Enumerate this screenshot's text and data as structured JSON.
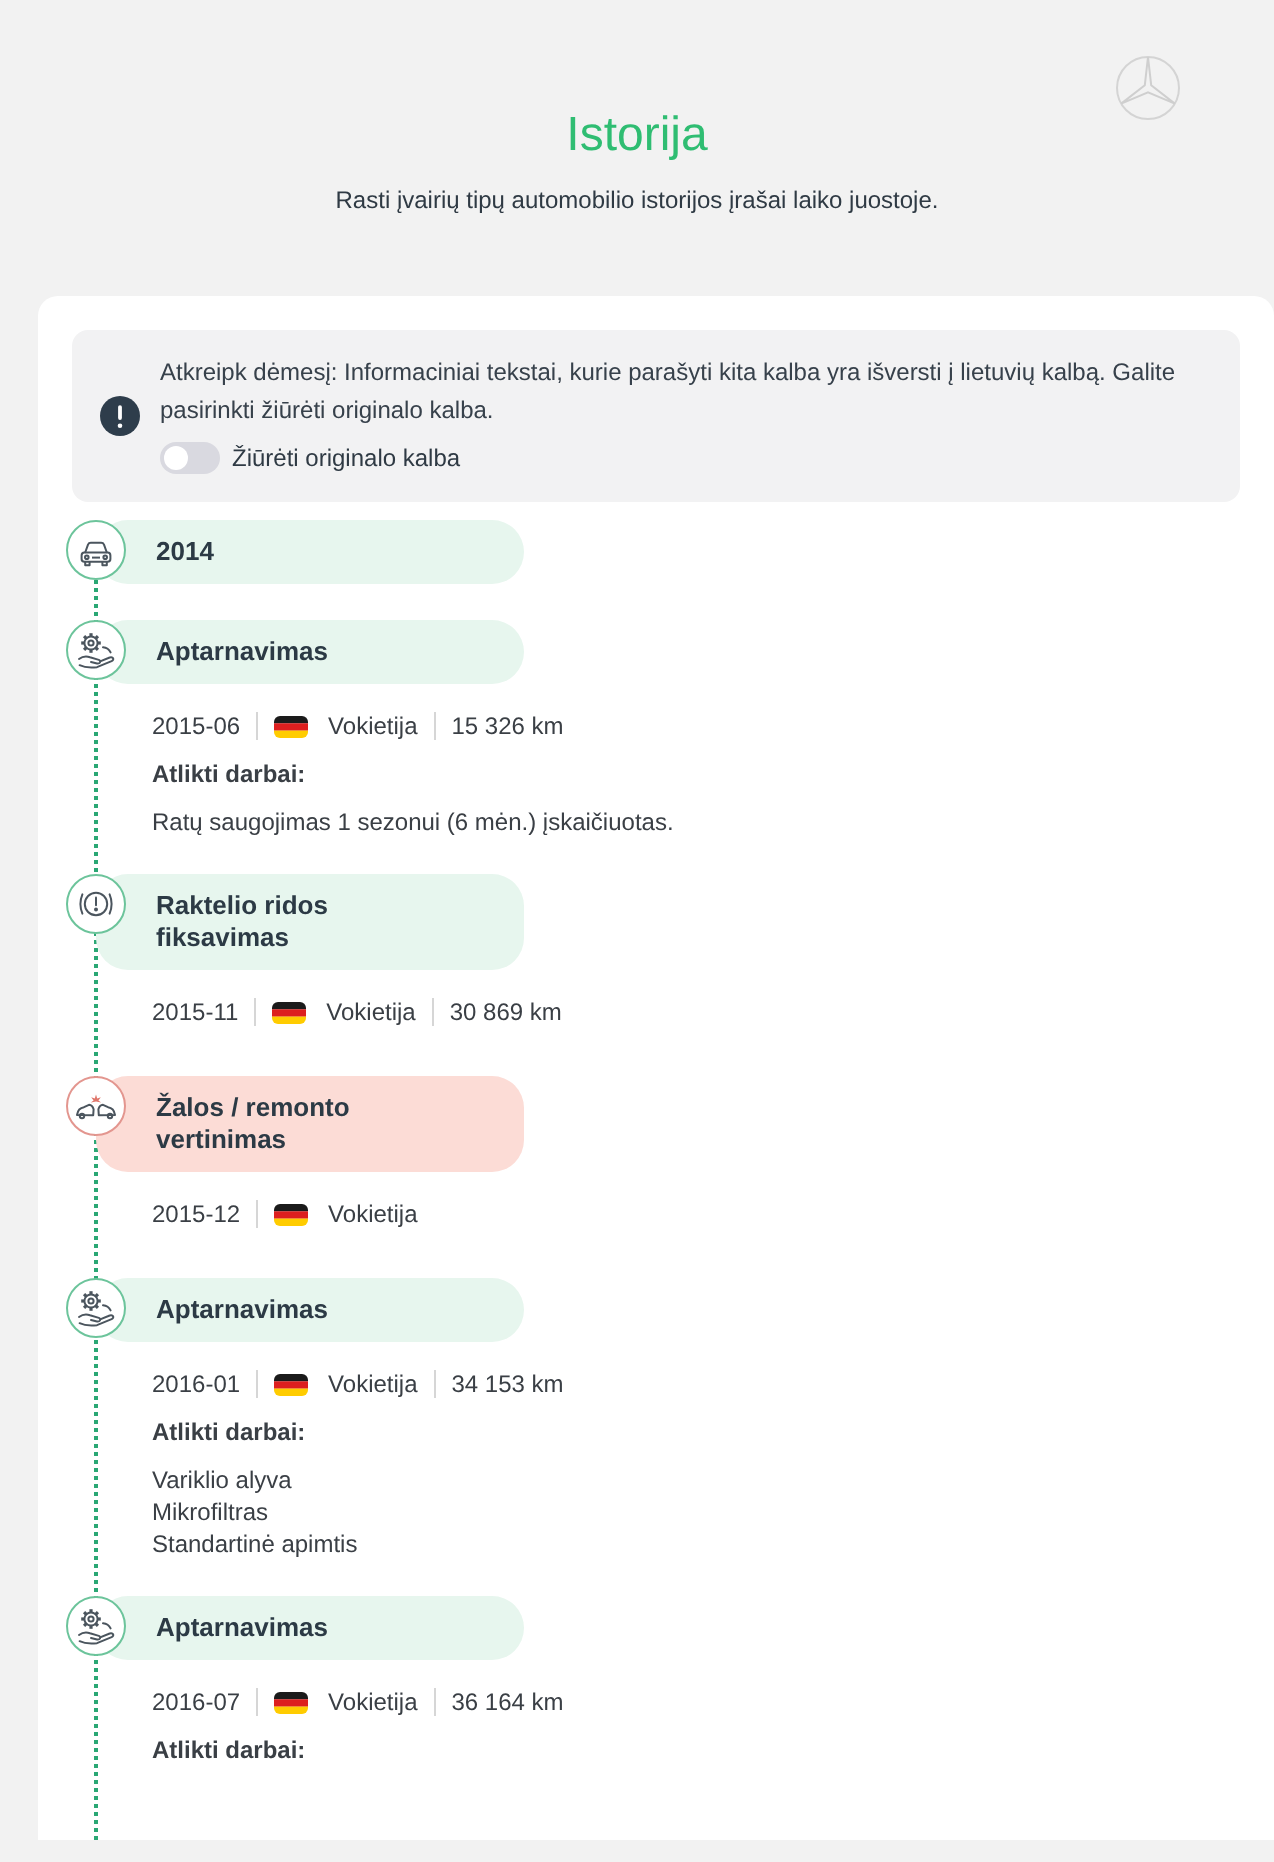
{
  "header": {
    "title": "Istorija",
    "subtitle": "Rasti įvairių tipų automobilio istorijos įrašai laiko juostoje."
  },
  "notice": {
    "text": "Atkreipk dėmesį: Informaciniai tekstai, kurie parašyti kita kalba yra išversti į lietuvių kalbą. Galite pasirinkti žiūrėti originalo kalba.",
    "toggle": {
      "label": "Žiūrėti originalo kalba",
      "on": false
    }
  },
  "timeline": [
    {
      "kind": "year",
      "title": "2014"
    },
    {
      "kind": "service",
      "title": "Aptarnavimas",
      "date": "2015-06",
      "country": "Vokietija",
      "mileage": "15 326 km",
      "works_title": "Atlikti darbai:",
      "works": [
        "Ratų saugojimas 1 sezonui (6 mėn.) įskaičiuotas."
      ]
    },
    {
      "kind": "mileage",
      "title": "Raktelio ridos fiksavimas",
      "date": "2015-11",
      "country": "Vokietija",
      "mileage": "30 869 km"
    },
    {
      "kind": "damage",
      "title": "Žalos / remonto vertinimas",
      "date": "2015-12",
      "country": "Vokietija"
    },
    {
      "kind": "service",
      "title": "Aptarnavimas",
      "date": "2016-01",
      "country": "Vokietija",
      "mileage": "34 153 km",
      "works_title": "Atlikti darbai:",
      "works": [
        "Variklio alyva",
        "Mikrofiltras",
        "Standartinė apimtis"
      ]
    },
    {
      "kind": "service",
      "title": "Aptarnavimas",
      "date": "2016-07",
      "country": "Vokietija",
      "mileage": "36 164 km",
      "works_title": "Atlikti darbai:"
    }
  ]
}
